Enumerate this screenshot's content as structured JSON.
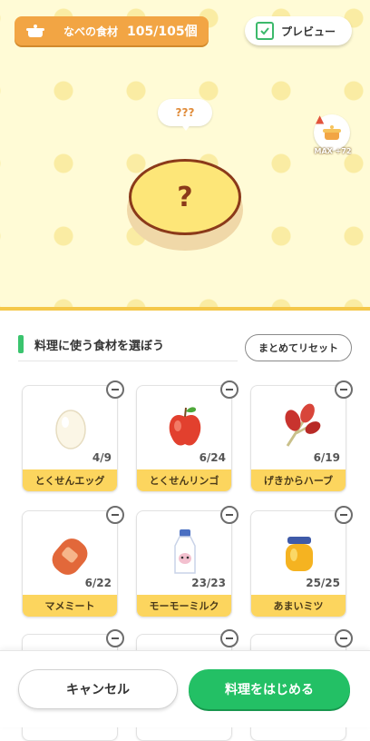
{
  "header": {
    "ingredients_label": "なべの食材",
    "ingredients_count": "105/105個",
    "preview_label": "プレビュー",
    "preview_checked": true
  },
  "dish": {
    "bubble_text": "???",
    "plate_mark": "?",
    "max_label": "MAX +72"
  },
  "section": {
    "title": "料理に使う食材を選ぼう",
    "reset_label": "まとめてリセット"
  },
  "ingredients": [
    {
      "name": "とくせんエッグ",
      "count": "4/9",
      "icon": "egg-icon"
    },
    {
      "name": "とくせんリンゴ",
      "count": "6/24",
      "icon": "apple-icon"
    },
    {
      "name": "げきからハーブ",
      "count": "6/19",
      "icon": "herb-icon"
    },
    {
      "name": "マメミート",
      "count": "6/22",
      "icon": "sausage-icon"
    },
    {
      "name": "モーモーミルク",
      "count": "23/23",
      "icon": "milk-icon"
    },
    {
      "name": "あまいミツ",
      "count": "25/25",
      "icon": "honey-jar-icon"
    }
  ],
  "footer": {
    "cancel_label": "キャンセル",
    "start_label": "料理をはじめる"
  },
  "colors": {
    "accent_green": "#23c065",
    "counter_orange": "#f2a544",
    "label_yellow": "#fcd55e",
    "plate_yellow": "#fde678"
  }
}
